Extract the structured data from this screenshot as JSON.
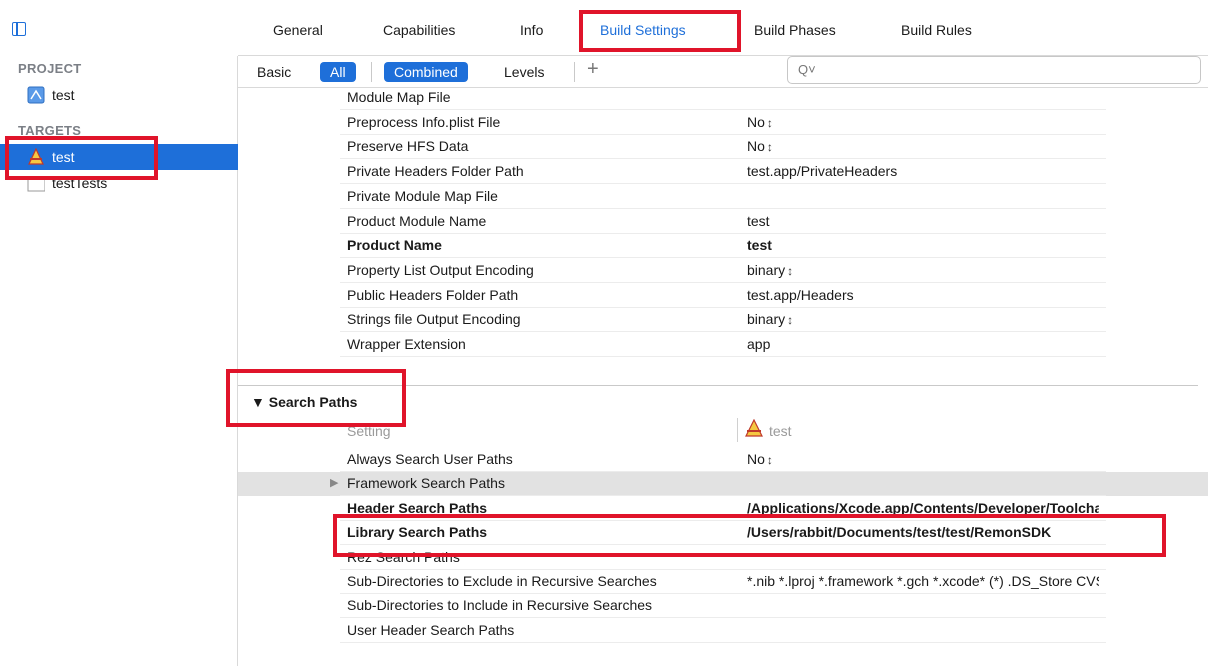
{
  "tabs": [
    "General",
    "Capabilities",
    "Info",
    "Build Settings",
    "Build Phases",
    "Build Rules"
  ],
  "active_tab": "Build Settings",
  "sidebar": {
    "project_header": "PROJECT",
    "project_item": "test",
    "targets_header": "TARGETS",
    "target_items": [
      "test",
      "testTests"
    ]
  },
  "filterbar": {
    "basic": "Basic",
    "all": "All",
    "combined": "Combined",
    "levels": "Levels",
    "add": "+",
    "search_icon": "Q˅"
  },
  "settings_top": [
    {
      "name": "Module Map File",
      "value": "",
      "stepper": false,
      "bold": false
    },
    {
      "name": "Preprocess Info.plist File",
      "value": "No",
      "stepper": true,
      "bold": false
    },
    {
      "name": "Preserve HFS Data",
      "value": "No",
      "stepper": true,
      "bold": false
    },
    {
      "name": "Private Headers Folder Path",
      "value": "test.app/PrivateHeaders",
      "stepper": false,
      "bold": false
    },
    {
      "name": "Private Module Map File",
      "value": "",
      "stepper": false,
      "bold": false
    },
    {
      "name": "Product Module Name",
      "value": "test",
      "stepper": false,
      "bold": false
    },
    {
      "name": "Product Name",
      "value": "test",
      "stepper": false,
      "bold": true
    },
    {
      "name": "Property List Output Encoding",
      "value": "binary",
      "stepper": true,
      "bold": false
    },
    {
      "name": "Public Headers Folder Path",
      "value": "test.app/Headers",
      "stepper": false,
      "bold": false
    },
    {
      "name": "Strings file Output Encoding",
      "value": "binary",
      "stepper": true,
      "bold": false
    },
    {
      "name": "Wrapper Extension",
      "value": "app",
      "stepper": false,
      "bold": false
    }
  ],
  "search_paths": {
    "title": "▼ Search Paths",
    "col_setting": "Setting",
    "col_target": "test",
    "rows": [
      {
        "name": "Always Search User Paths",
        "value": "No",
        "stepper": true,
        "bold": false
      },
      {
        "name": "Framework Search Paths",
        "value": "",
        "stepper": false,
        "bold": false
      },
      {
        "name": "Header Search Paths",
        "value": "/Applications/Xcode.app/Contents/Developer/Toolchain...",
        "stepper": false,
        "bold": true
      },
      {
        "name": "Library Search Paths",
        "value": "/Users/rabbit/Documents/test/test/RemonSDK",
        "stepper": false,
        "bold": true
      },
      {
        "name": "Rez Search Paths",
        "value": "",
        "stepper": false,
        "bold": false
      },
      {
        "name": "Sub-Directories to Exclude in Recursive Searches",
        "value": "*.nib *.lproj *.framework *.gch *.xcode* (*) .DS_Store CVS .sv...",
        "stepper": false,
        "bold": false
      },
      {
        "name": "Sub-Directories to Include in Recursive Searches",
        "value": "",
        "stepper": false,
        "bold": false
      },
      {
        "name": "User Header Search Paths",
        "value": "",
        "stepper": false,
        "bold": false
      }
    ]
  },
  "stepper_glyph": "↕"
}
